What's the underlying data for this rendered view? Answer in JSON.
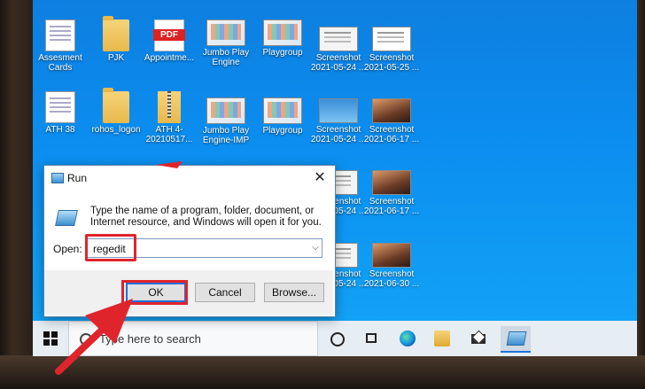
{
  "desktop": {
    "icons": [
      {
        "label": "Assesment Cards"
      },
      {
        "label": "PJK"
      },
      {
        "label": "Appointme..."
      },
      {
        "label": "Jumbo Play Engine"
      },
      {
        "label": "Playgroup"
      },
      {
        "label": "Screenshot 2021-05-24 ..."
      },
      {
        "label": "Screenshot 2021-05-25 ..."
      },
      {
        "label": "ATH 38"
      },
      {
        "label": "rohos_logon"
      },
      {
        "label": "ATH 4-20210517..."
      },
      {
        "label": "Jumbo Play Engine-IMP"
      },
      {
        "label": "Playgroup"
      },
      {
        "label": "Screenshot 2021-05-24 ..."
      },
      {
        "label": "Screenshot 2021-06-17 ..."
      },
      {
        "label": "Screenshot 2021-05-24 ..."
      },
      {
        "label": "Screenshot 2021-06-17 ..."
      },
      {
        "label": "Screenshot 2021-05-24 ..."
      },
      {
        "label": "Screenshot 2021-06-30 ..."
      }
    ],
    "pdf_badge": "PDF"
  },
  "taskbar": {
    "search_placeholder": "Type here to search"
  },
  "run_dialog": {
    "title": "Run",
    "close_glyph": "✕",
    "description": "Type the name of a program, folder, document, or Internet resource, and Windows will open it for you.",
    "open_label": "Open:",
    "open_value": "regedit",
    "dropdown_glyph": "⌵",
    "ok_label": "OK",
    "cancel_label": "Cancel",
    "browse_label": "Browse..."
  },
  "colors": {
    "annotation_red": "#e0242c",
    "desktop_blue": "#0b8ef0"
  }
}
